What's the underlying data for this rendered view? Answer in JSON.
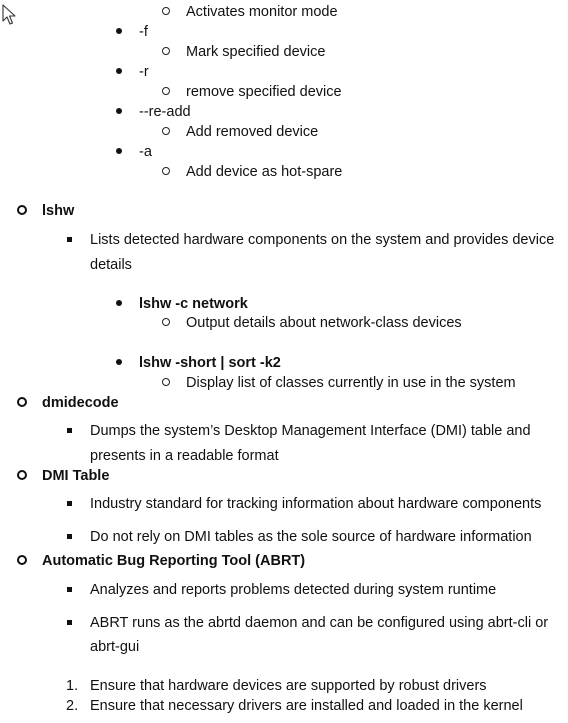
{
  "cursor": {
    "icon": "mouse-pointer-icon"
  },
  "items": [
    {
      "id": "l1",
      "marker": "circle",
      "text": "Activates monitor mode",
      "bold": false
    },
    {
      "id": "l2",
      "marker": "dot",
      "text": "-f",
      "bold": false
    },
    {
      "id": "l3",
      "marker": "circle",
      "text": "Mark specified device",
      "bold": false
    },
    {
      "id": "l4",
      "marker": "dot",
      "text": "-r",
      "bold": false
    },
    {
      "id": "l5",
      "marker": "circle",
      "text": "remove specified device",
      "bold": false
    },
    {
      "id": "l6",
      "marker": "dot",
      "text": "--re-add",
      "bold": false
    },
    {
      "id": "l7",
      "marker": "circle",
      "text": "Add removed device",
      "bold": false
    },
    {
      "id": "l8",
      "marker": "dot",
      "text": "-a",
      "bold": false
    },
    {
      "id": "l9",
      "marker": "circle",
      "text": "Add device as hot-spare",
      "bold": false
    },
    {
      "id": "l10",
      "marker": "circle-bold",
      "text": "lshw",
      "bold": true
    },
    {
      "id": "l11",
      "marker": "square",
      "text": "Lists detected hardware components on the system and provides device",
      "bold": false
    },
    {
      "id": "l12",
      "marker": "none",
      "text": "details",
      "bold": false
    },
    {
      "id": "l13",
      "marker": "dot",
      "text": "lshw -c network",
      "bold": true
    },
    {
      "id": "l14",
      "marker": "circle",
      "text": "Output details about network-class devices",
      "bold": false
    },
    {
      "id": "l15",
      "marker": "dot",
      "text": "lshw -short | sort -k2",
      "bold": true
    },
    {
      "id": "l16",
      "marker": "circle",
      "text": "Display list of classes currently in use in the system",
      "bold": false
    },
    {
      "id": "l17",
      "marker": "circle-bold",
      "text": "dmidecode",
      "bold": true
    },
    {
      "id": "l18",
      "marker": "square",
      "text": "Dumps the system’s Desktop Management Interface (DMI) table and",
      "bold": false
    },
    {
      "id": "l19",
      "marker": "none",
      "text": "presents in a readable format",
      "bold": false
    },
    {
      "id": "l20",
      "marker": "circle-bold",
      "text": "DMI Table",
      "bold": true
    },
    {
      "id": "l21",
      "marker": "square",
      "text": "Industry standard for tracking information about hardware components",
      "bold": false
    },
    {
      "id": "l22",
      "marker": "square",
      "text": "Do not rely on DMI tables as the sole source of hardware information",
      "bold": false
    },
    {
      "id": "l23",
      "marker": "circle-bold",
      "text": "Automatic Bug Reporting Tool (ABRT)",
      "bold": true
    },
    {
      "id": "l24",
      "marker": "square",
      "text": "Analyzes and reports problems detected during system runtime",
      "bold": false
    },
    {
      "id": "l25",
      "marker": "square",
      "text": "ABRT runs as the abrtd daemon and can be configured using abrt-cli or",
      "bold": false
    },
    {
      "id": "l26",
      "marker": "none",
      "text": "abrt-gui",
      "bold": false
    },
    {
      "id": "l27",
      "marker": "number",
      "number": "1.",
      "text": "Ensure that hardware devices are supported by robust drivers",
      "bold": false
    },
    {
      "id": "l28",
      "marker": "number",
      "number": "2.",
      "text": "Ensure that necessary drivers are installed and loaded in the kernel",
      "bold": false
    }
  ]
}
